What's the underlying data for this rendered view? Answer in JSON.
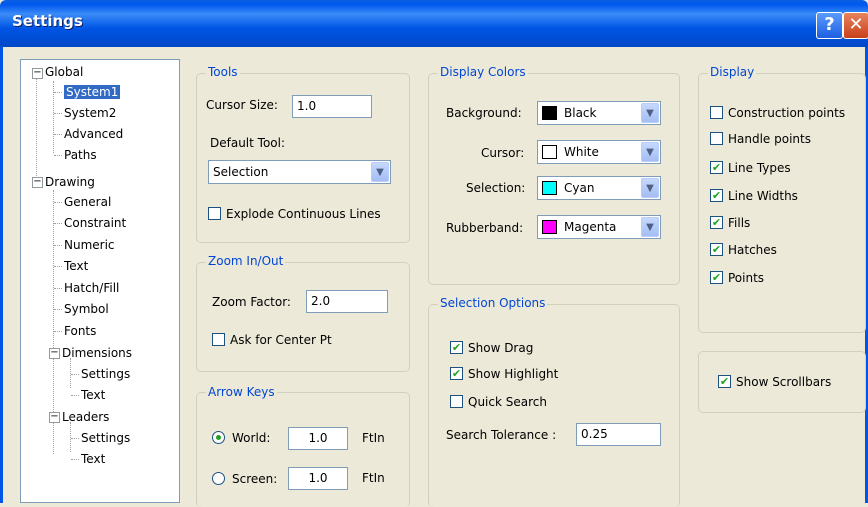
{
  "window": {
    "title": "Settings",
    "help_glyph": "?",
    "close_glyph": "✕"
  },
  "tree": {
    "items": [
      {
        "label": "Global",
        "expander": "−"
      },
      {
        "label": "System1",
        "selected": true
      },
      {
        "label": "System2"
      },
      {
        "label": "Advanced"
      },
      {
        "label": "Paths"
      },
      {
        "label": "Drawing",
        "expander": "−"
      },
      {
        "label": "General"
      },
      {
        "label": "Constraint"
      },
      {
        "label": "Numeric"
      },
      {
        "label": "Text"
      },
      {
        "label": "Hatch/Fill"
      },
      {
        "label": "Symbol"
      },
      {
        "label": "Fonts"
      },
      {
        "label": "Dimensions",
        "expander": "−"
      },
      {
        "label": "Settings"
      },
      {
        "label": "Text"
      },
      {
        "label": "Leaders",
        "expander": "−"
      },
      {
        "label": "Settings"
      },
      {
        "label": "Text"
      }
    ]
  },
  "tools": {
    "title": "Tools",
    "cursor_size_label": "Cursor Size:",
    "cursor_size_value": "1.0",
    "default_tool_label": "Default Tool:",
    "default_tool_value": "Selection",
    "explode_label": "Explode Continuous Lines",
    "explode_checked": false
  },
  "zoom": {
    "title": "Zoom In/Out",
    "factor_label": "Zoom Factor:",
    "factor_value": "2.0",
    "ask_center_label": "Ask for Center Pt",
    "ask_center_checked": false
  },
  "arrow_keys": {
    "title": "Arrow Keys",
    "world_label": "World:",
    "world_value": "1.0",
    "world_unit": "FtIn",
    "screen_label": "Screen:",
    "screen_value": "1.0",
    "screen_unit": "FtIn",
    "selected": "world"
  },
  "display_colors": {
    "title": "Display Colors",
    "rows": [
      {
        "label": "Background:",
        "value": "Black",
        "color": "#000000"
      },
      {
        "label": "Cursor:",
        "value": "White",
        "color": "#ffffff"
      },
      {
        "label": "Selection:",
        "value": "Cyan",
        "color": "#00ffff"
      },
      {
        "label": "Rubberband:",
        "value": "Magenta",
        "color": "#ff00ff"
      }
    ]
  },
  "selection_options": {
    "title": "Selection Options",
    "show_drag_label": "Show Drag",
    "show_drag_checked": true,
    "show_highlight_label": "Show Highlight",
    "show_highlight_checked": true,
    "quick_search_label": "Quick Search",
    "quick_search_checked": false,
    "tolerance_label": "Search Tolerance :",
    "tolerance_value": "0.25"
  },
  "display": {
    "title": "Display",
    "items": [
      {
        "label": "Construction points",
        "checked": false
      },
      {
        "label": "Handle points",
        "checked": false
      },
      {
        "label": "Line Types",
        "checked": true
      },
      {
        "label": "Line Widths",
        "checked": true
      },
      {
        "label": "Fills",
        "checked": true
      },
      {
        "label": "Hatches",
        "checked": true
      },
      {
        "label": "Points",
        "checked": true
      }
    ]
  },
  "scrollbars": {
    "label": "Show Scrollbars",
    "checked": true
  },
  "glyphs": {
    "check": "✔",
    "dropdown": "▼"
  }
}
